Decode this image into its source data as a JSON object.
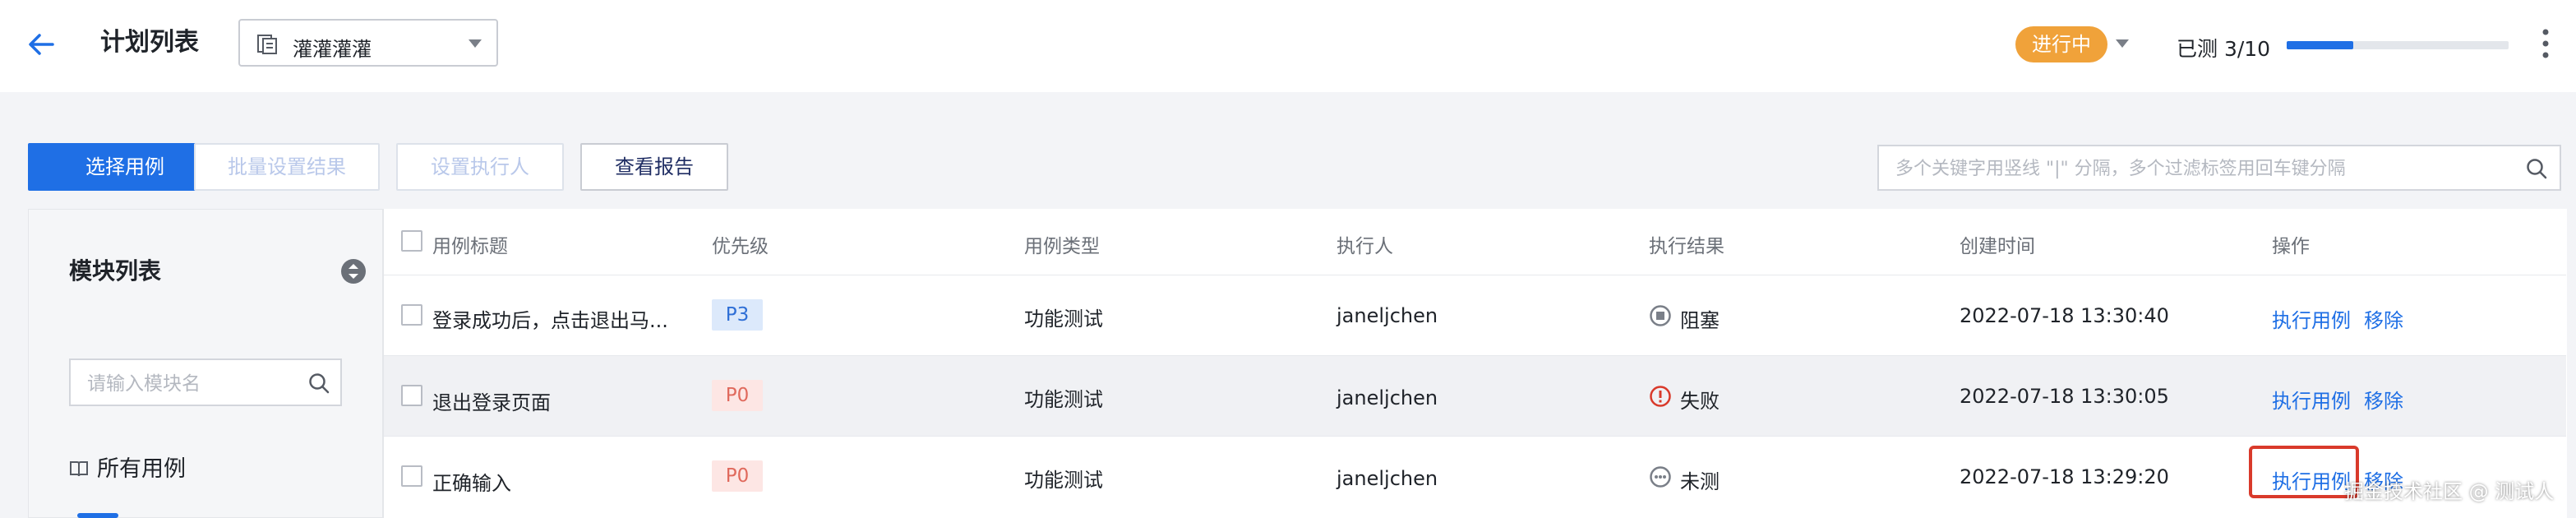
{
  "header": {
    "title": "计划列表",
    "plan_select": {
      "value": "灌灌灌灌"
    },
    "status": "进行中",
    "progress_text": "已测 3/10",
    "progress_fraction": 0.3
  },
  "toolbar": {
    "select_cases": "选择用例",
    "batch_set_result": "批量设置结果",
    "set_executor": "设置执行人",
    "view_report": "查看报告",
    "search_placeholder": "多个关键字用竖线 \"|\" 分隔，多个过滤标签用回车键分隔"
  },
  "module_panel": {
    "title": "模块列表",
    "search_placeholder": "请输入模块名",
    "all_cases": "所有用例"
  },
  "table": {
    "columns": [
      "用例标题",
      "优先级",
      "用例类型",
      "执行人",
      "执行结果",
      "创建时间",
      "操作"
    ],
    "rows": [
      {
        "title": "登录成功后，点击退出马...",
        "priority": "P3",
        "type": "功能测试",
        "executor": "janeljchen",
        "result": "阻塞",
        "result_icon": "blocked-icon",
        "created": "2022-07-18 13:30:40",
        "action_execute": "执行用例",
        "action_remove": "移除"
      },
      {
        "title": "退出登录页面",
        "priority": "P0",
        "type": "功能测试",
        "executor": "janeljchen",
        "result": "失败",
        "result_icon": "failed-icon",
        "created": "2022-07-18 13:30:05",
        "action_execute": "执行用例",
        "action_remove": "移除"
      },
      {
        "title": "正确输入",
        "priority": "P0",
        "type": "功能测试",
        "executor": "janeljchen",
        "result": "未测",
        "result_icon": "untested-icon",
        "created": "2022-07-18 13:29:20",
        "action_execute": "执行用例",
        "action_remove": "移除"
      }
    ]
  },
  "watermark": "掘金技术社区 @ 测试人",
  "colors": {
    "primary": "#1f6fe5",
    "status_in_progress": "#f0a23a",
    "failed": "#d93a2b",
    "highlight": "#d93a2b"
  }
}
